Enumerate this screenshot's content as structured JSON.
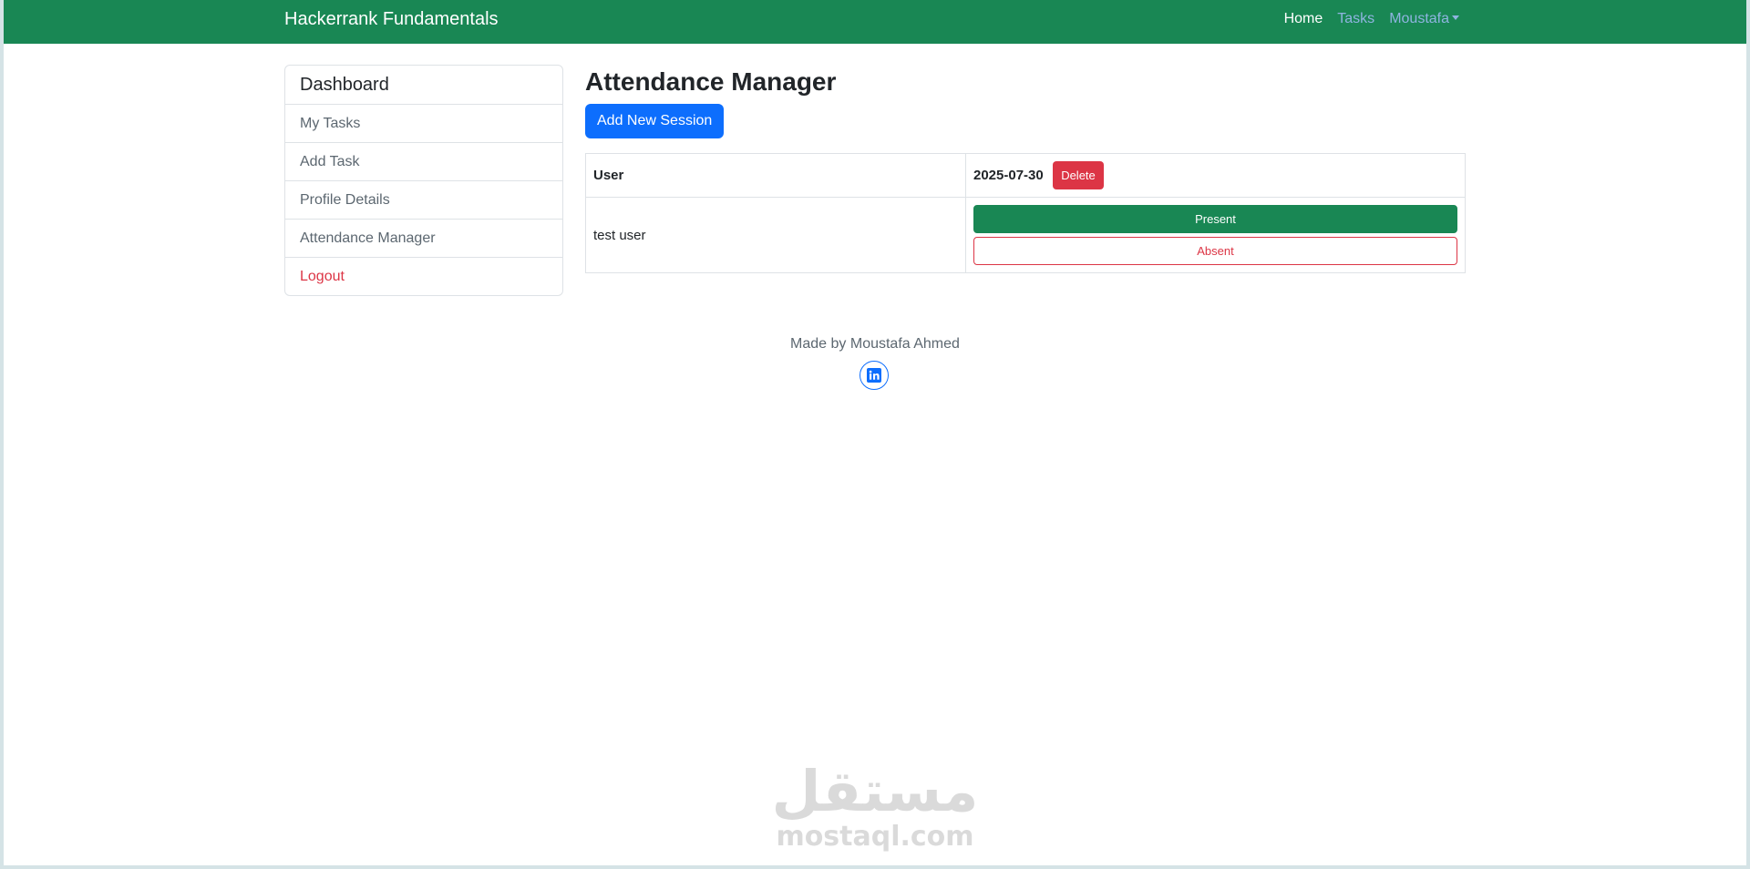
{
  "navbar": {
    "brand": "Hackerrank Fundamentals",
    "links": {
      "home": "Home",
      "tasks": "Tasks",
      "user": "Moustafa"
    }
  },
  "sidebar": {
    "title": "Dashboard",
    "items": [
      "My Tasks",
      "Add Task",
      "Profile Details",
      "Attendance Manager",
      "Logout"
    ]
  },
  "main": {
    "title": "Attendance Manager",
    "add_session_label": "Add New Session",
    "table": {
      "user_header": "User",
      "session_date": "2025-07-30",
      "delete_label": "Delete",
      "rows": [
        {
          "user": "test user",
          "present_label": "Present",
          "absent_label": "Absent"
        }
      ]
    }
  },
  "footer": {
    "made_by": "Made by Moustafa Ahmed"
  },
  "watermark": {
    "arabic": "مستقل",
    "latin": "mostaql.com"
  },
  "colors": {
    "navbar": "#198754",
    "primary": "#0d6efd",
    "danger": "#dc3545",
    "success": "#198754"
  },
  "icons": {
    "footer": "linkedin-icon",
    "user_menu": "chevron-down-icon"
  }
}
